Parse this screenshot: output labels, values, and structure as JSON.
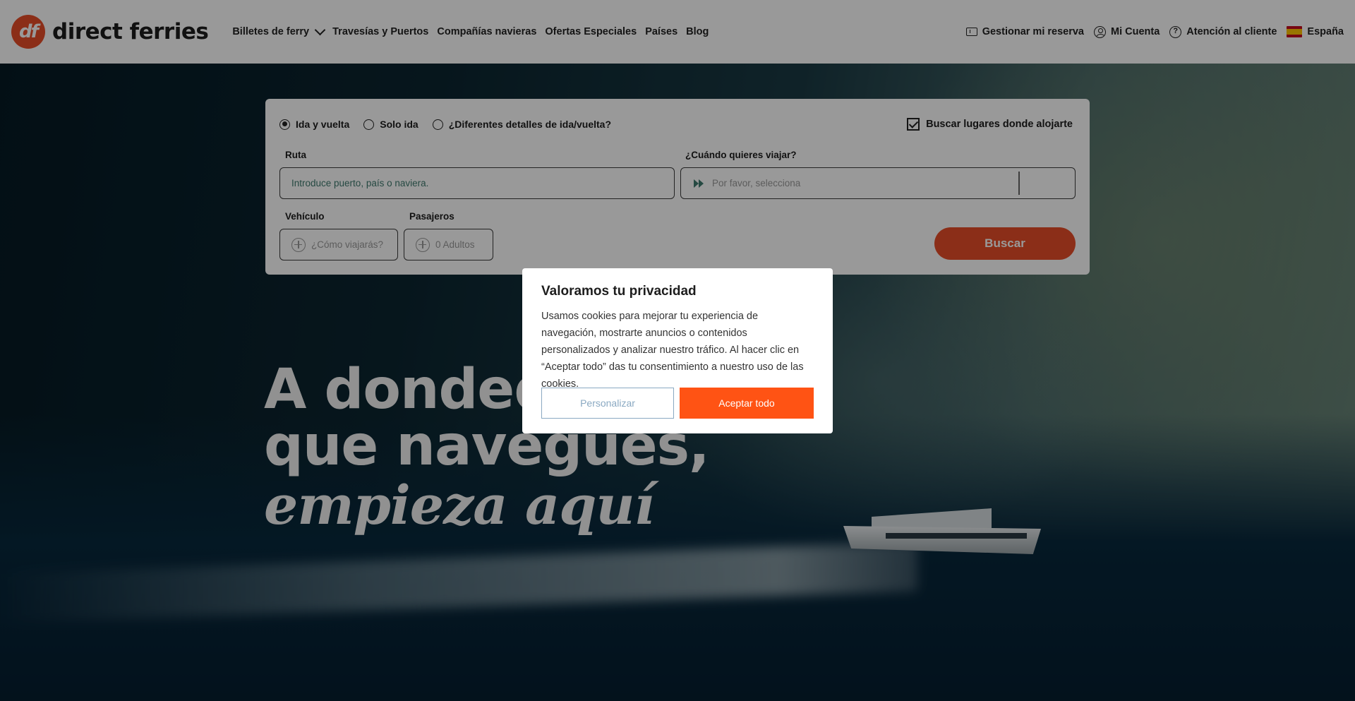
{
  "brand": {
    "badge": "df",
    "name": "direct ferries",
    "color": "#e84e28"
  },
  "nav": {
    "items": [
      {
        "label": "Billetes de ferry",
        "has_dropdown": true
      },
      {
        "label": "Travesías y Puertos"
      },
      {
        "label": "Compañías navieras"
      },
      {
        "label": "Ofertas Especiales"
      },
      {
        "label": "Países"
      },
      {
        "label": "Blog"
      }
    ],
    "right": {
      "manage": "Gestionar mi reserva",
      "account": "Mi Cuenta",
      "support": "Atención al cliente",
      "country": "España"
    }
  },
  "search": {
    "trip_types": [
      {
        "label": "Ida y vuelta",
        "selected": true
      },
      {
        "label": "Solo ida",
        "selected": false
      },
      {
        "label": "¿Diferentes detalles de ida/vuelta?",
        "selected": false
      }
    ],
    "accommodation": {
      "label": "Buscar lugares donde alojarte",
      "checked": true
    },
    "route": {
      "label": "Ruta",
      "placeholder": "Introduce puerto, país o naviera."
    },
    "date": {
      "label": "¿Cuándo quieres viajar?",
      "placeholder": "Por favor, selecciona"
    },
    "vehicle": {
      "label": "Vehículo",
      "placeholder": "¿Cómo viajarás?"
    },
    "passengers": {
      "label": "Pasajeros",
      "value": "0 Adultos"
    },
    "submit": "Buscar"
  },
  "hero": {
    "line1": "A dondequiera",
    "line2": "que navegues,",
    "line3": "empieza aquí"
  },
  "cookie": {
    "title": "Valoramos tu privacidad",
    "text": "Usamos cookies para mejorar tu experiencia de navegación, mostrarte anuncios o contenidos personalizados y analizar nuestro tráfico. Al hacer clic en “Aceptar todo” das tu consentimiento a nuestro uso de las cookies.",
    "customize": "Personalizar",
    "accept": "Aceptar todo",
    "accent": "#ff5314"
  }
}
